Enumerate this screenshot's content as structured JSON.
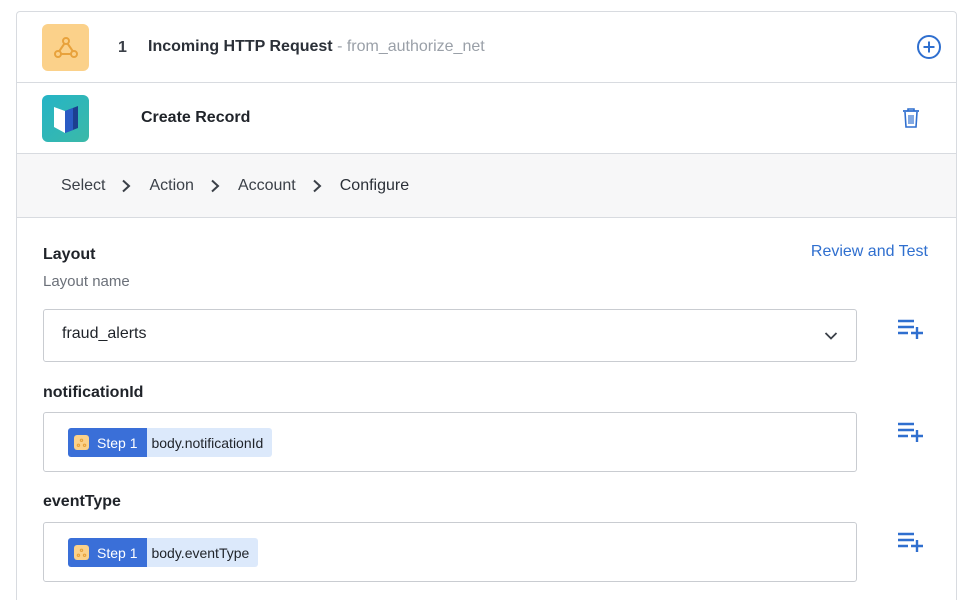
{
  "trigger": {
    "icon": "webhook-icon",
    "step_number": "1",
    "title": "Incoming HTTP Request",
    "subtitle": "- from_authorize_net"
  },
  "action": {
    "icon": "filemaker-icon",
    "title": "Create Record"
  },
  "breadcrumb": {
    "items": [
      "Select",
      "Action",
      "Account",
      "Configure"
    ]
  },
  "review_link": "Review and Test",
  "layout_field": {
    "label": "Layout",
    "help": "Layout name",
    "value": "fraud_alerts"
  },
  "fields": [
    {
      "label": "notificationId",
      "pill_step": "Step 1",
      "pill_path": "body.notificationId"
    },
    {
      "label": "eventType",
      "pill_step": "Step 1",
      "pill_path": "body.eventType"
    }
  ],
  "colors": {
    "accent": "#2f6fcf",
    "pill_step_bg": "#3a6fd8",
    "pill_path_bg": "#dce9fb",
    "webhook_tile": "#fbd18a"
  }
}
